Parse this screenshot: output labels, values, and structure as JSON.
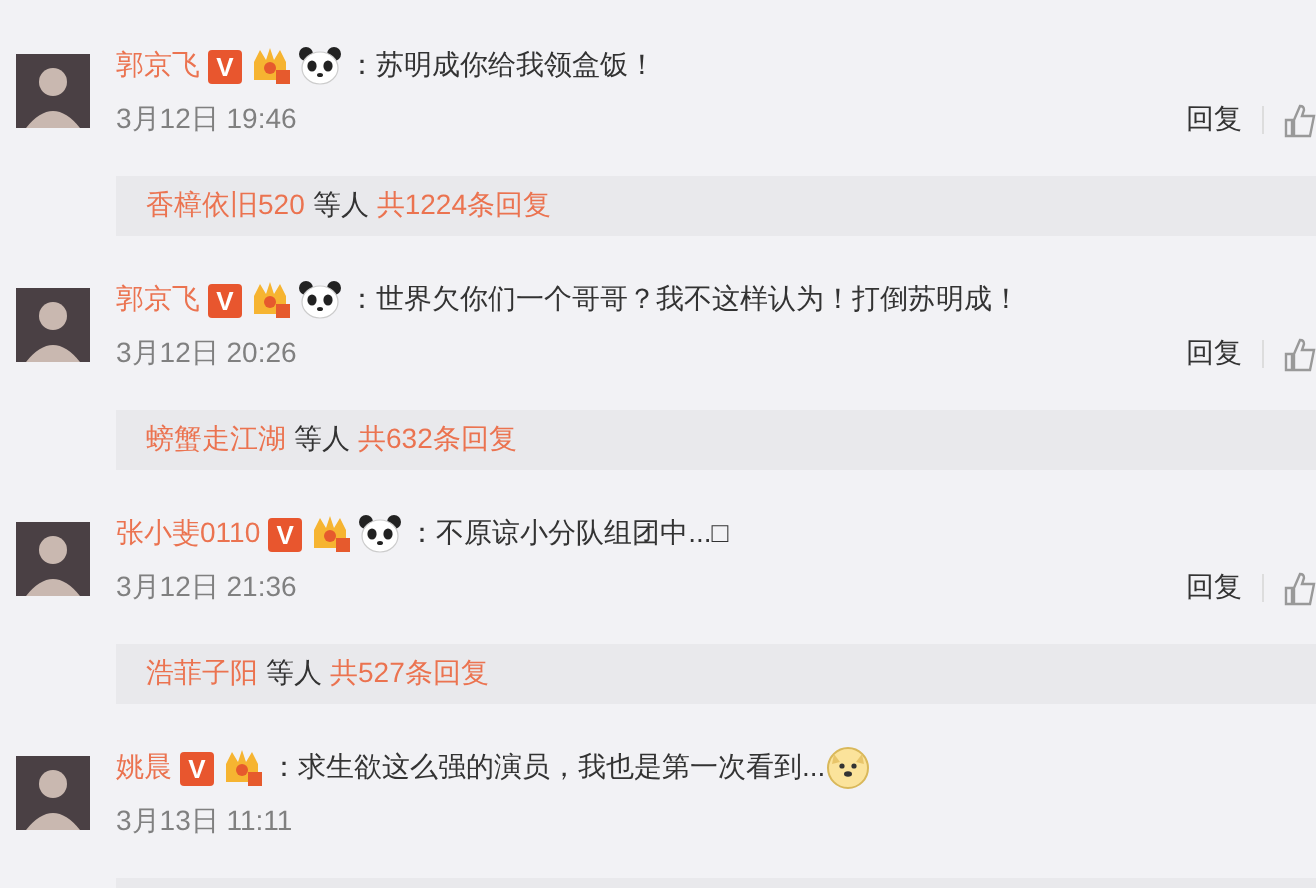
{
  "comments": [
    {
      "name": "郭京飞",
      "badges": [
        {
          "kind": "vip",
          "text": "V"
        },
        {
          "kind": "crown"
        },
        {
          "kind": "panda"
        }
      ],
      "text": "：苏明成你给我领盒饭！",
      "date": "3月12日 19:46",
      "reply_action": "回复",
      "replies": {
        "names": "香樟依旧520",
        "middle": "等人",
        "count": "共1224条回复"
      }
    },
    {
      "name": "郭京飞",
      "badges": [
        {
          "kind": "vip",
          "text": "V"
        },
        {
          "kind": "crown"
        },
        {
          "kind": "panda"
        }
      ],
      "text": "：世界欠你们一个哥哥？我不这样认为！打倒苏明成！",
      "date": "3月12日 20:26",
      "reply_action": "回复",
      "replies": {
        "names": "螃蟹走江湖",
        "middle": "等人",
        "count": "共632条回复"
      }
    },
    {
      "name": "张小斐0110",
      "badges": [
        {
          "kind": "vip",
          "text": "V"
        },
        {
          "kind": "crown"
        },
        {
          "kind": "panda"
        }
      ],
      "text": "：不原谅小分队组团中...□",
      "date": "3月12日 21:36",
      "reply_action": "回复",
      "replies": {
        "names": "浩菲子阳",
        "middle": "等人",
        "count": "共527条回复"
      }
    },
    {
      "name": "姚晨",
      "badges": [
        {
          "kind": "vip",
          "text": "V"
        },
        {
          "kind": "crown"
        }
      ],
      "text": "：求生欲这么强的演员，我也是第一次看到...",
      "end_icons": [
        {
          "kind": "doge"
        }
      ],
      "date": "3月13日 11:11"
    }
  ]
}
